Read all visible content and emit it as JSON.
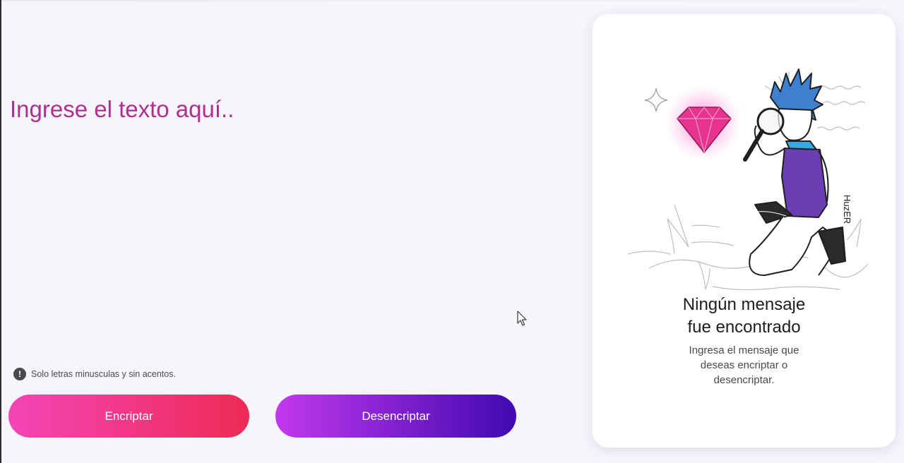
{
  "input": {
    "placeholder": "Ingrese el texto aquí..",
    "value": ""
  },
  "hint": {
    "icon": "info-icon",
    "icon_glyph": "!",
    "text": "Solo letras minusculas y sin acentos."
  },
  "buttons": {
    "encrypt_label": "Encriptar",
    "decrypt_label": "Desencriptar"
  },
  "output_card": {
    "title_line1": "Ningún mensaje",
    "title_line2": "fue encontrado",
    "message_line1": "Ingresa el mensaje que",
    "message_line2": "deseas encriptar o",
    "message_line3": "desencriptar.",
    "illustration": "boy-with-magnifying-glass-and-gem-illustration",
    "illustration_signature": "HuzER"
  },
  "colors": {
    "background": "#f6f5fc",
    "input_text": "#b02e91",
    "encrypt_gradient_start": "#f445b7",
    "encrypt_gradient_end": "#ee2a55",
    "decrypt_gradient_start": "#c238ee",
    "decrypt_gradient_end": "#4009b0",
    "card_background": "#ffffff"
  }
}
